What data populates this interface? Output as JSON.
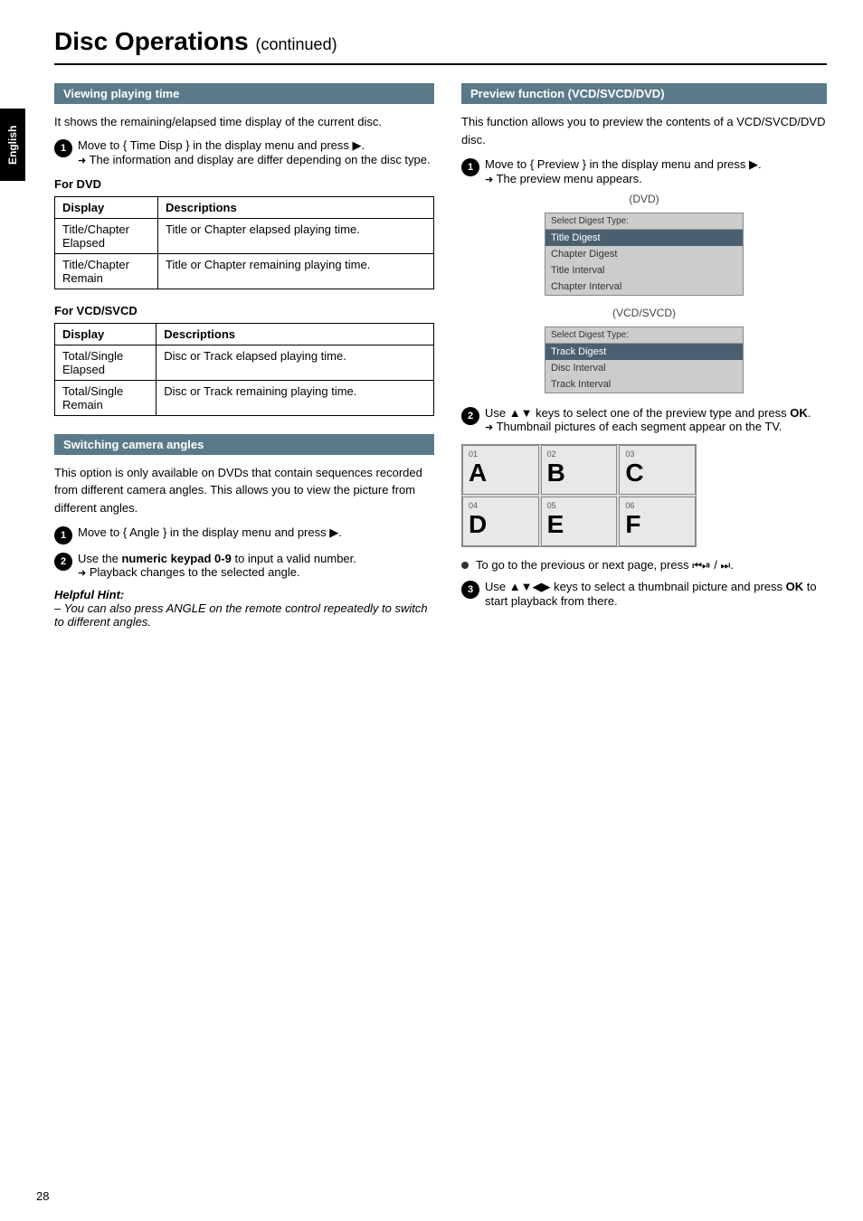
{
  "page": {
    "title": "Disc Operations",
    "continued": "(continued)",
    "page_number": "28",
    "sidebar_label": "English"
  },
  "left_column": {
    "section1": {
      "header": "Viewing playing time",
      "intro": "It shows the remaining/elapsed time display of the current disc.",
      "step1_text": "Move to { Time Disp } in the display menu and press",
      "step1_arrow": "▶",
      "step1_note": "The information and display are differ depending on the disc type.",
      "for_dvd": {
        "label": "For DVD",
        "columns": [
          "Display",
          "Descriptions"
        ],
        "rows": [
          [
            "Title/Chapter Elapsed",
            "Title or Chapter elapsed playing time."
          ],
          [
            "Title/Chapter Remain",
            "Title or Chapter remaining playing time."
          ]
        ]
      },
      "for_vcd": {
        "label": "For VCD/SVCD",
        "columns": [
          "Display",
          "Descriptions"
        ],
        "rows": [
          [
            "Total/Single Elapsed",
            "Disc or Track elapsed playing time."
          ],
          [
            "Total/Single Remain",
            "Disc or Track remaining playing time."
          ]
        ]
      }
    },
    "section2": {
      "header": "Switching camera angles",
      "intro": "This option is only available on DVDs that contain sequences recorded from different camera angles. This allows you to view the picture from different angles.",
      "step1_text": "Move to { Angle } in the display menu and press",
      "step1_arrow": "▶",
      "step2_text": "Use the",
      "step2_bold": "numeric keypad 0-9",
      "step2_text2": "to input a valid number.",
      "step2_note": "Playback changes to the selected angle.",
      "helpful_hint_label": "Helpful Hint:",
      "helpful_hint_text": "– You can also press ANGLE on the remote control repeatedly to switch to different angles."
    }
  },
  "right_column": {
    "section1": {
      "header": "Preview function (VCD/SVCD/DVD)",
      "intro": "This function allows you to preview the contents of a VCD/SVCD/DVD disc.",
      "step1_text": "Move to { Preview } in the display menu and press",
      "step1_arrow": "▶",
      "step1_note": "The preview menu appears.",
      "dvd_label": "(DVD)",
      "dvd_menu": {
        "title": "Select Digest Type:",
        "items": [
          {
            "label": "Title  Digest",
            "selected": true
          },
          {
            "label": "Chapter  Digest",
            "selected": false
          },
          {
            "label": "Title Interval",
            "selected": false
          },
          {
            "label": "Chapter Interval",
            "selected": false
          }
        ]
      },
      "vcd_label": "(VCD/SVCD)",
      "vcd_menu": {
        "title": "Select Digest Type:",
        "items": [
          {
            "label": "Track  Digest",
            "selected": true
          },
          {
            "label": "Disc Interval",
            "selected": false
          },
          {
            "label": "Track Interval",
            "selected": false
          }
        ]
      },
      "step2_text": "Use",
      "step2_keys": "▲▼",
      "step2_text2": "keys to select one of the preview type and press",
      "step2_bold": "OK",
      "step2_note": "Thumbnail pictures of each segment appear on the TV.",
      "thumbnail_grid": [
        {
          "num": "01",
          "letter": "A"
        },
        {
          "num": "02",
          "letter": "B"
        },
        {
          "num": "03",
          "letter": "C"
        },
        {
          "num": "04",
          "letter": "D"
        },
        {
          "num": "05",
          "letter": "E"
        },
        {
          "num": "06",
          "letter": "F"
        }
      ],
      "bullet1_text": "To go to the previous or next page, press",
      "bullet1_icons": "◀◀ / ▶▶◀",
      "step3_text": "Use",
      "step3_keys": "▲▼◀▶",
      "step3_text2": "keys to select a thumbnail picture and press",
      "step3_bold": "OK",
      "step3_text3": "to start playback from there."
    }
  }
}
